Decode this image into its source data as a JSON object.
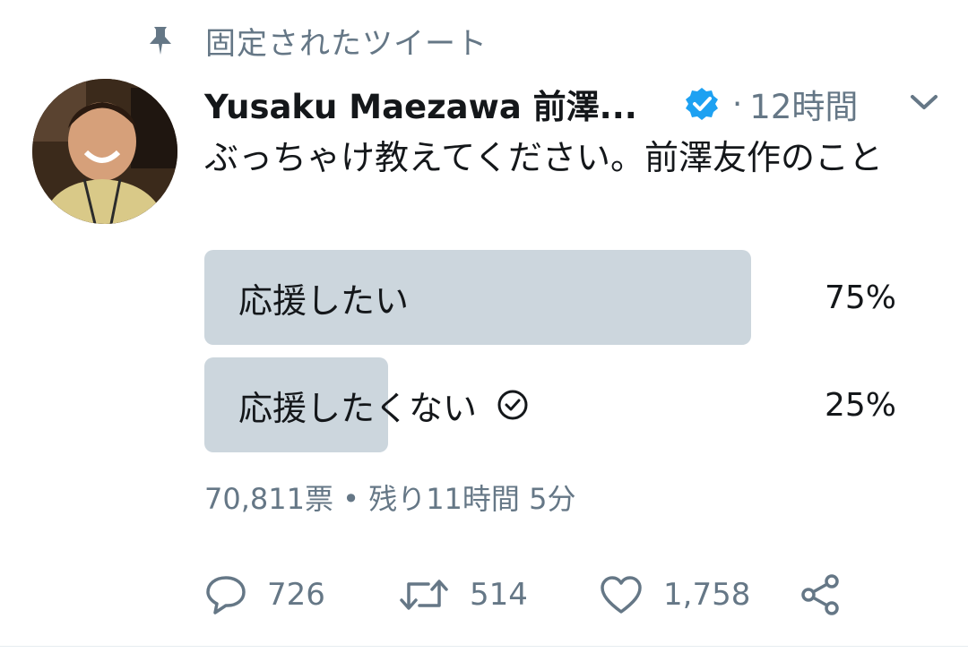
{
  "pinned": {
    "label": "固定されたツイート",
    "icon": "pin-icon"
  },
  "tweet": {
    "author_name": "Yusaku Maezawa 前澤...",
    "verified_icon": "verified-badge-icon",
    "separator": "·",
    "time": "12時間",
    "text": "ぶっちゃけ教えてください。前澤友作のこと"
  },
  "poll": {
    "options": [
      {
        "label": "応援したい",
        "percent_label": "75%",
        "fraction": 0.79,
        "voted": false
      },
      {
        "label": "応援したくない",
        "percent_label": "25%",
        "fraction": 0.265,
        "voted": true
      }
    ],
    "meta": "70,811票 • 残り11時間 5分"
  },
  "actions": {
    "reply_count": "726",
    "retweet_count": "514",
    "like_count": "1,758"
  },
  "colors": {
    "bar": "#ccd6dd",
    "muted": "#657786",
    "verified": "#1da1f2",
    "text": "#14171a"
  }
}
